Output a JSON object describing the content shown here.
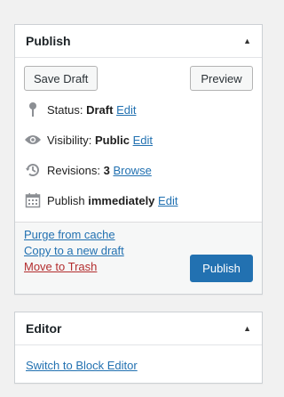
{
  "publish": {
    "title": "Publish",
    "save_draft": "Save Draft",
    "preview": "Preview",
    "status_label": "Status:",
    "status_value": "Draft",
    "visibility_label": "Visibility:",
    "visibility_value": "Public",
    "revisions_label": "Revisions:",
    "revisions_value": "3",
    "browse": "Browse",
    "publish_label": "Publish",
    "publish_value": "immediately",
    "edit": "Edit",
    "purge_cache": "Purge from cache",
    "copy_draft": "Copy to a new draft",
    "move_trash": "Move to Trash",
    "publish_button": "Publish"
  },
  "editor": {
    "title": "Editor",
    "switch_link": "Switch to Block Editor"
  },
  "colors": {
    "link": "#2271b1",
    "primary_button": "#2271b1",
    "trash": "#b32d2e"
  }
}
